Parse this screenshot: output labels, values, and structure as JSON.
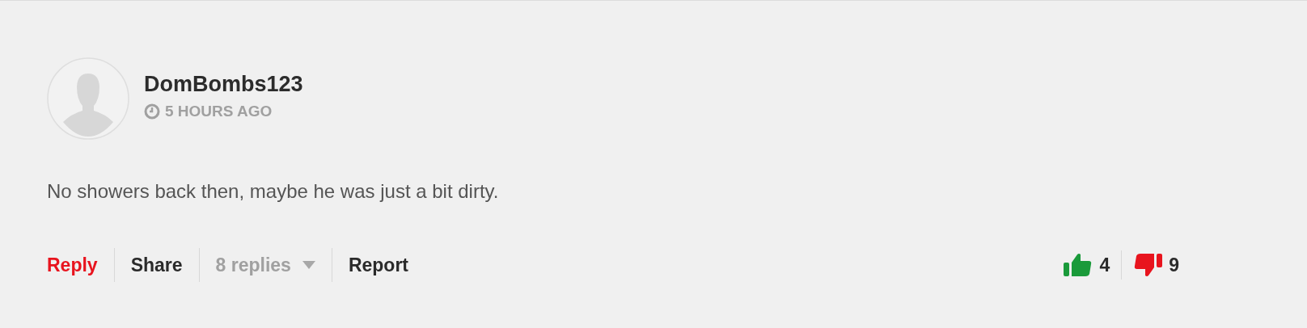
{
  "comment": {
    "author": "DomBombs123",
    "time": "5 HOURS AGO",
    "body": "No showers back then, maybe he was just a bit dirty.",
    "actions": [
      {
        "kind": "reply",
        "label": "Reply"
      },
      {
        "kind": "share",
        "label": "Share"
      },
      {
        "kind": "replies",
        "label": "8 replies"
      },
      {
        "kind": "report",
        "label": "Report"
      }
    ],
    "votes": [
      {
        "kind": "up",
        "count": "4"
      },
      {
        "kind": "down",
        "count": "9"
      }
    ]
  }
}
